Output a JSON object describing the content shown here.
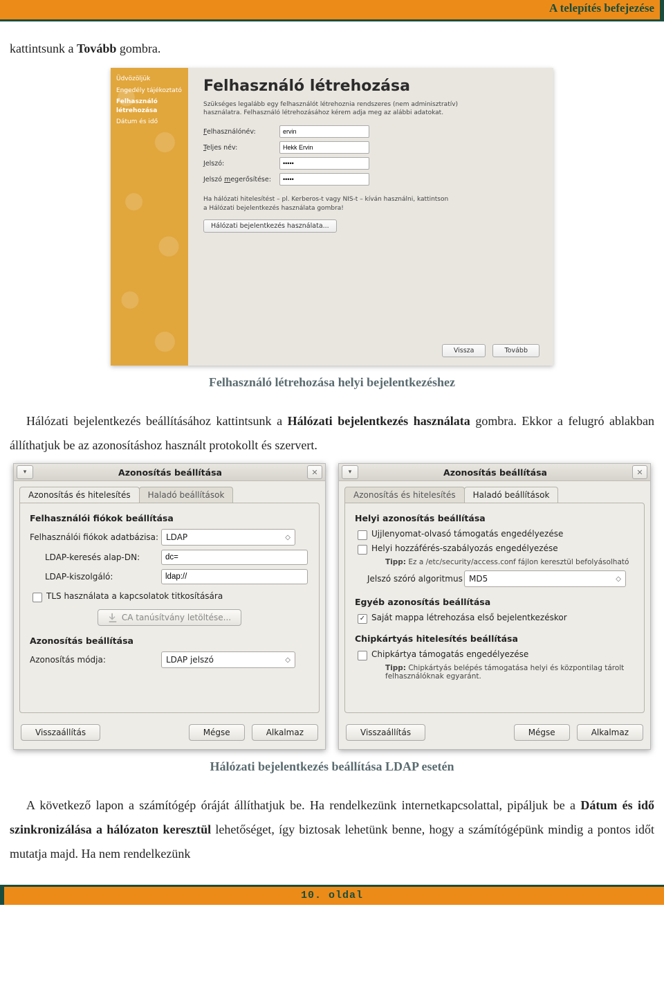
{
  "header": {
    "title": "A telepítés befejezése"
  },
  "para1": {
    "pre": "kattintsunk a ",
    "bold": "Tovább",
    "post": " gombra."
  },
  "shot1": {
    "side": {
      "items": [
        "Üdvözöljük",
        "Engedély tájékoztató",
        "Felhasználó létrehozása",
        "Dátum és idő"
      ],
      "active_index": 2
    },
    "title": "Felhasználó létrehozása",
    "desc": "Szükséges legalább egy felhasználót létrehoznia rendszeres (nem adminisztratív) használatra. Felhasználó létrehozásához kérem adja meg az alábbi adatokat.",
    "rows": {
      "username_label": "Felhasználónév:",
      "username_value": "ervin",
      "fullname_label": "Teljes név:",
      "fullname_value": "Hekk Ervin",
      "password_label": "Jelszó:",
      "password_value": "•••••",
      "confirm_label": "Jelszó megerősítése:",
      "confirm_value": "•••••"
    },
    "note": "Ha hálózati hitelesítést – pl. Kerberos-t vagy NIS-t – kíván használni, kattintson a Hálózati bejelentkezés használata gombra!",
    "net_btn": "Hálózati bejelentkezés használata...",
    "back": "Vissza",
    "next": "Tovább"
  },
  "caption1": "Felhasználó létrehozása helyi bejelentkezéshez",
  "para2": {
    "seg1": "Hálózati bejelentkezés beállításához kattintsunk a ",
    "bold1": "Hálózati bejelentkezés használata",
    "seg2": " gombra. Ekkor a felugró ablakban állíthatjuk be az azonosításhoz használt protokollt és szervert."
  },
  "dlgA": {
    "title": "Azonosítás beállítása",
    "tab1": "Azonosítás és hitelesítés",
    "tab2": "Haladó beállítások",
    "group1": "Felhasználói fiókok beállítása",
    "db_label": "Felhasználói fiókok adatbázisa:",
    "db_value": "LDAP",
    "basedn_label": "LDAP-keresés alap-DN:",
    "basedn_value": "dc=",
    "server_label": "LDAP-kiszolgáló:",
    "server_value": "ldap://",
    "tls_label": "TLS használata a kapcsolatok titkosítására",
    "ca_btn": "CA tanúsítvány letöltése...",
    "group2": "Azonosítás beállítása",
    "mode_label": "Azonosítás módja:",
    "mode_value": "LDAP jelszó",
    "reset": "Visszaállítás",
    "cancel": "Mégse",
    "apply": "Alkalmaz"
  },
  "dlgB": {
    "title": "Azonosítás beállítása",
    "tab1": "Azonosítás és hitelesítés",
    "tab2": "Haladó beállítások",
    "group1": "Helyi azonosítás beállítása",
    "chk_fp": "Ujjlenyomat-olvasó támogatás engedélyezése",
    "chk_access": "Helyi hozzáférés-szabályozás engedélyezése",
    "tip1_b": "Tipp:",
    "tip1": " Ez a /etc/security/access.conf fájlon keresztül befolyásolható",
    "hash_label": "Jelszó szóró algoritmus",
    "hash_value": "MD5",
    "group2": "Egyéb azonosítás beállítása",
    "chk_home": "Saját mappa létrehozása első bejelentkezéskor",
    "group3": "Chipkártyás hitelesítés beállítása",
    "chk_chip": "Chipkártya támogatás engedélyezése",
    "tip2_b": "Tipp:",
    "tip2": " Chipkártyás belépés támogatása helyi és központilag tárolt felhasználóknak egyaránt.",
    "reset": "Visszaállítás",
    "cancel": "Mégse",
    "apply": "Alkalmaz"
  },
  "caption2": "Hálózati bejelentkezés beállítása LDAP esetén",
  "para3": {
    "seg1": "A következő lapon a számítógép óráját állíthatjuk be. Ha rendelkezünk internetkapcsolattal, pipáljuk be a ",
    "bold1": "Dátum és idő szinkronizálása a hálózaton keresztül",
    "seg2": " lehetőséget, így biztosak lehetünk benne, hogy a számítógépünk mindig a pontos időt mutatja majd. Ha nem rendelkezünk"
  },
  "footer": {
    "text": "10. oldal"
  }
}
